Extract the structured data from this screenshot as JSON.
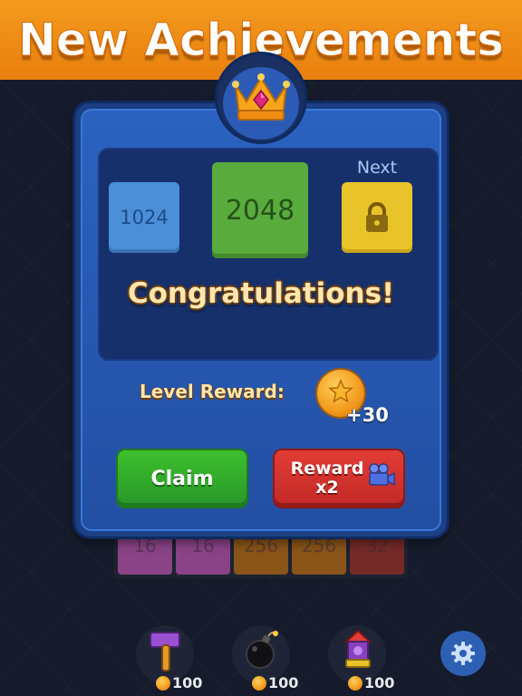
{
  "banner": {
    "title": "New Achievements"
  },
  "board": {
    "tiles": [
      {
        "value": "16",
        "color": "#7d3c78"
      },
      {
        "value": "16",
        "color": "#7d3c78"
      },
      {
        "value": "256",
        "color": "#7a4e18"
      },
      {
        "value": "256",
        "color": "#7a4e18"
      },
      {
        "value": "32",
        "color": "#6a2626"
      }
    ]
  },
  "dialog": {
    "icon": "crown-icon",
    "achieved_tile": "1024",
    "current_tile": "2048",
    "next_label": "Next",
    "next_tile_icon": "lock-icon",
    "headline": "Congratulations!",
    "reward_label": "Level Reward:",
    "reward_amount": "+30",
    "reward_icon": "coin-icon",
    "claim_label": "Claim",
    "reward_x2_line1": "Reward",
    "reward_x2_line2": "x2",
    "reward_x2_icon": "video-camera-icon"
  },
  "tools": [
    {
      "name": "hammer",
      "icon": "hammer-icon",
      "price": "100"
    },
    {
      "name": "bomb",
      "icon": "bomb-icon",
      "price": "100"
    },
    {
      "name": "rocket",
      "icon": "rocket-icon",
      "price": "100"
    }
  ],
  "settings": {
    "icon": "gear-icon"
  },
  "colors": {
    "banner": "#ea7f0e",
    "dialog": "#2b62bf",
    "claim": "#27962a",
    "reward": "#c22a26",
    "tile_1024": "#4a8fd8",
    "tile_2048": "#5aab3d",
    "tile_locked": "#e8c42a"
  }
}
